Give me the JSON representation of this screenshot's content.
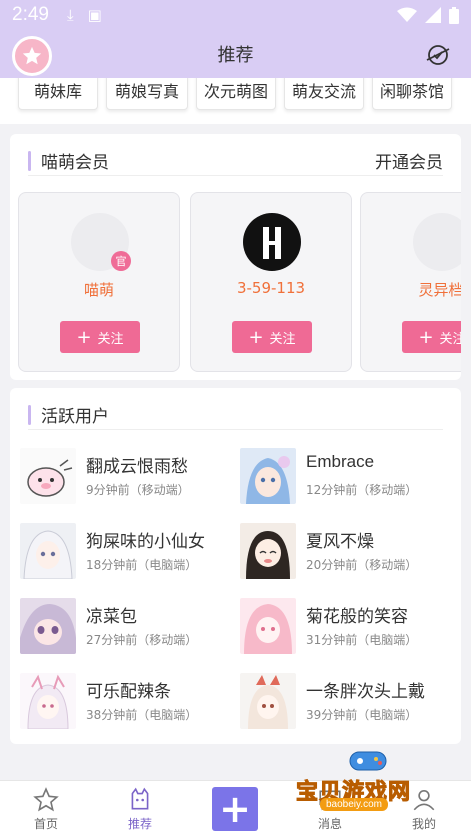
{
  "status_bar": {
    "time": "2:49"
  },
  "header": {
    "title": "推荐"
  },
  "tags": [
    "萌妹库",
    "萌娘写真",
    "次元萌图",
    "萌友交流",
    "闲聊茶馆"
  ],
  "vip_section": {
    "title": "喵萌会员",
    "link": "开通会员",
    "members": [
      {
        "name": "喵萌",
        "badge": "官",
        "follow": "关注"
      },
      {
        "name": "3-59-113",
        "follow": "关注"
      },
      {
        "name": "灵异档",
        "follow": "关注"
      }
    ]
  },
  "active_section": {
    "title": "活跃用户",
    "users": [
      {
        "name": "翻成云恨雨愁",
        "meta": "9分钟前（移动端）"
      },
      {
        "name": "Embrace",
        "meta": "12分钟前（移动端）"
      },
      {
        "name": "狗屎味的小仙女",
        "meta": "18分钟前（电脑端）"
      },
      {
        "name": "夏风不燥",
        "meta": "20分钟前（移动端）"
      },
      {
        "name": "凉菜包",
        "meta": "27分钟前（移动端）"
      },
      {
        "name": "菊花般的笑容",
        "meta": "31分钟前（电脑端）"
      },
      {
        "name": "可乐配辣条",
        "meta": "38分钟前（电脑端）"
      },
      {
        "name": "一条胖次头上戴",
        "meta": "39分钟前（电脑端）"
      }
    ]
  },
  "bottom_nav": {
    "home": "首页",
    "recommend": "推荐",
    "messages": "消息",
    "mine": "我的"
  },
  "watermark": {
    "text": "宝贝游戏网",
    "url": "baobeiy.com"
  },
  "colors": {
    "header_bg": "#d9cdf4",
    "follow_button": "#ef6a95",
    "name_accent": "#f0703a",
    "active_tab": "#7b64c8",
    "add_button": "#7b74e8"
  }
}
